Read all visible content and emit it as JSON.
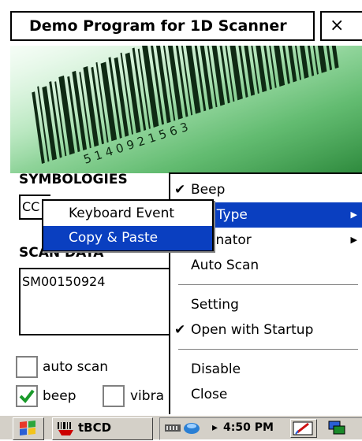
{
  "window": {
    "title": "Demo Program for 1D Scanner",
    "close_glyph": "×"
  },
  "banner": {
    "description_icon": "barcode-banner-icon",
    "digits": "5 1 4 0 9 2 1 5 6 3"
  },
  "symbologies": {
    "label": "SYMBOLOGIES",
    "value": "CC"
  },
  "scan_data": {
    "label": "SCAN DATA",
    "value": "SM00150924"
  },
  "checkboxes": {
    "auto_scan": {
      "label": "auto scan",
      "checked": false
    },
    "beep": {
      "label": "beep",
      "checked": true
    },
    "vibrate": {
      "label": "vibra",
      "checked": false
    }
  },
  "context_menu": {
    "items": [
      {
        "label": "Beep",
        "checked": true,
        "has_submenu": false
      },
      {
        "label": "lt Type",
        "checked": false,
        "has_submenu": true,
        "highlighted": true
      },
      {
        "label": "ninator",
        "checked": false,
        "has_submenu": true
      },
      {
        "label": "Auto Scan",
        "checked": false,
        "has_submenu": false
      },
      {
        "label": "Setting",
        "checked": false,
        "has_submenu": false
      },
      {
        "label": "Open with Startup",
        "checked": true,
        "has_submenu": false
      },
      {
        "label": "Disable",
        "checked": false,
        "has_submenu": false
      },
      {
        "label": "Close",
        "checked": false,
        "has_submenu": false
      }
    ],
    "check_glyph": "✔",
    "arrow_glyph": "▶"
  },
  "submenu": {
    "items": [
      {
        "label": "Keyboard Event",
        "highlighted": false
      },
      {
        "label": "Copy & Paste",
        "highlighted": true
      }
    ]
  },
  "taskbar": {
    "start_icon": "windows-flag-icon",
    "app_label": "tBCD",
    "time": "4:50 PM",
    "arrow": "▸",
    "colors": {
      "background": "#d4d0c8",
      "highlight": "#0a3fc0"
    }
  }
}
